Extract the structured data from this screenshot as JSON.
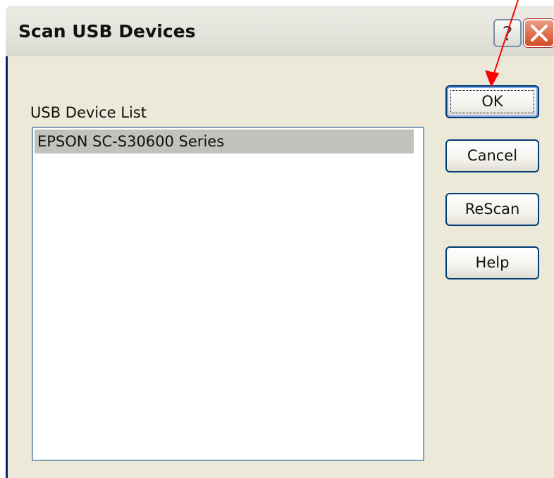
{
  "window": {
    "title": "Scan USB Devices",
    "help_glyph": "?",
    "close_icon": "close-icon"
  },
  "device_list": {
    "label": "USB Device List",
    "items": [
      "EPSON SC-S30600 Series"
    ],
    "selected_index": 0
  },
  "buttons": {
    "ok": "OK",
    "cancel": "Cancel",
    "rescan": "ReScan",
    "help": "Help"
  },
  "annotation": {
    "type": "arrow",
    "color": "#ff0000",
    "points_to": "ok-button"
  }
}
